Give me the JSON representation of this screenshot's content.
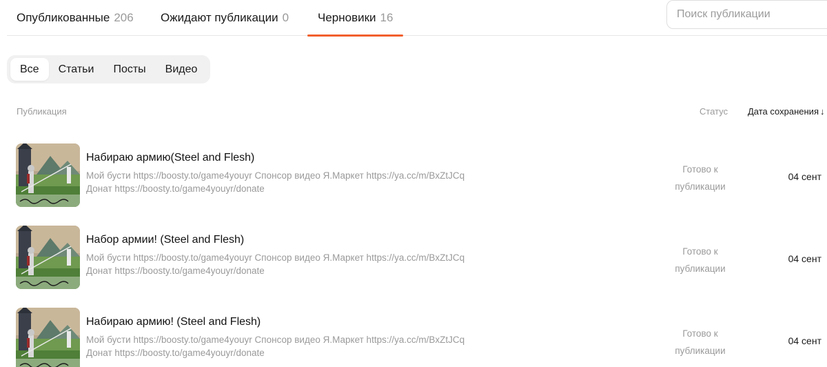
{
  "tabs": [
    {
      "label": "Опубликованные",
      "count": "206"
    },
    {
      "label": "Ожидают публикации",
      "count": "0"
    },
    {
      "label": "Черновики",
      "count": "16"
    }
  ],
  "active_tab_index": 2,
  "search": {
    "placeholder": "Поиск публикации",
    "value": ""
  },
  "filters": [
    {
      "label": "Все",
      "active": true
    },
    {
      "label": "Статьи",
      "active": false
    },
    {
      "label": "Посты",
      "active": false
    },
    {
      "label": "Видео",
      "active": false
    }
  ],
  "table": {
    "col_publication": "Публикация",
    "col_status": "Статус",
    "col_date": "Дата сохранения",
    "sort_icon": "arrow-down-icon"
  },
  "rows": [
    {
      "title": "Набираю армию(Steel and Flesh)",
      "desc1": "Мой бусти https://boosty.to/game4youyr Спонсор видео Я.Маркет https://ya.cc/m/BxZtJCq",
      "desc2": "Донат https://boosty.to/game4youyr/donate",
      "status1": "Готово к",
      "status2": "публикации",
      "date": "04 сент"
    },
    {
      "title": "Набор армии! (Steel and Flesh)",
      "desc1": "Мой бусти https://boosty.to/game4youyr Спонсор видео Я.Маркет https://ya.cc/m/BxZtJCq",
      "desc2": "Донат https://boosty.to/game4youyr/donate",
      "status1": "Готово к",
      "status2": "публикации",
      "date": "04 сент"
    },
    {
      "title": "Набираю армию! (Steel and Flesh)",
      "desc1": "Мой бусти https://boosty.to/game4youyr Спонсор видео Я.Маркет https://ya.cc/m/BxZtJCq",
      "desc2": "Донат https://boosty.to/game4youyr/donate",
      "status1": "Готово к",
      "status2": "публикации",
      "date": "04 сент"
    }
  ],
  "colors": {
    "accent": "#f15f2c",
    "muted": "#9a9a9a",
    "text": "#1a1a1a"
  }
}
